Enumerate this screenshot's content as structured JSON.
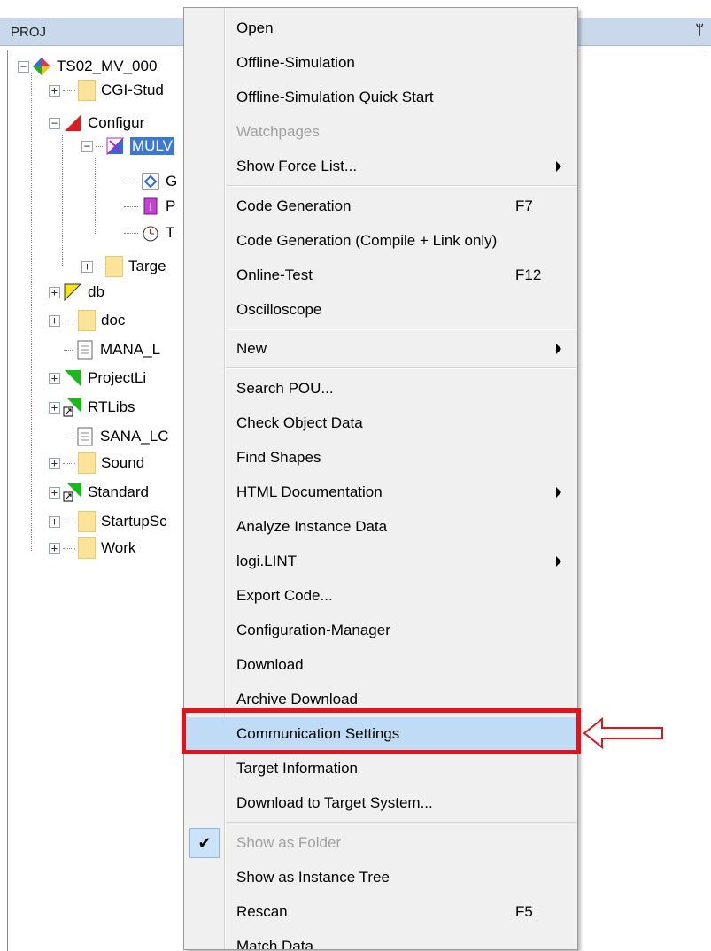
{
  "panel": {
    "title": "PROJ",
    "pin_icon": "pin-icon"
  },
  "tree": [
    {
      "label": "TS02_MV_000",
      "icon": "project-diamond-icon",
      "expander": "⊟"
    },
    {
      "label": "CGI-Stud",
      "icon": "folder-icon",
      "expander": "+"
    },
    {
      "label": "Configur",
      "icon": "configuration-triangle-icon",
      "expander": "−"
    },
    {
      "label": "MULV",
      "icon": "resource-icon",
      "expander": "−",
      "selected": true
    },
    {
      "label": "G",
      "icon": "global-variables-icon"
    },
    {
      "label": "P",
      "icon": "program-icon"
    },
    {
      "label": "T",
      "icon": "task-timer-icon"
    },
    {
      "label": "Targe",
      "icon": "folder-icon",
      "expander": "+"
    },
    {
      "label": "db",
      "icon": "db-triangle-icon",
      "expander": "+"
    },
    {
      "label": "doc",
      "icon": "folder-icon",
      "expander": "+"
    },
    {
      "label": "MANA_L",
      "icon": "file-icon"
    },
    {
      "label": "ProjectLi",
      "icon": "library-triangle-icon",
      "expander": "+"
    },
    {
      "label": "RTLibs",
      "icon": "linked-library-icon",
      "expander": "+"
    },
    {
      "label": "SANA_LC",
      "icon": "file-icon"
    },
    {
      "label": "Sound",
      "icon": "folder-icon",
      "expander": "+"
    },
    {
      "label": "Standard",
      "icon": "linked-library-icon",
      "expander": "+"
    },
    {
      "label": "StartupSc",
      "icon": "folder-icon",
      "expander": "+"
    },
    {
      "label": "Work",
      "icon": "folder-icon",
      "expander": "+"
    }
  ],
  "menu": {
    "items": [
      {
        "label": "Open"
      },
      {
        "label": "Offline-Simulation"
      },
      {
        "label": "Offline-Simulation Quick Start"
      },
      {
        "label": "Watchpages",
        "disabled": true
      },
      {
        "label": "Show Force List...",
        "submenu": true
      },
      {
        "label": "Code Generation",
        "shortcut": "F7"
      },
      {
        "label": "Code Generation (Compile + Link only)"
      },
      {
        "label": "Online-Test",
        "shortcut": "F12"
      },
      {
        "label": "Oscilloscope"
      },
      {
        "label": "New",
        "submenu": true
      },
      {
        "label": "Search POU..."
      },
      {
        "label": "Check Object Data"
      },
      {
        "label": "Find Shapes"
      },
      {
        "label": "HTML Documentation",
        "submenu": true
      },
      {
        "label": "Analyze Instance Data"
      },
      {
        "label": "logi.LINT",
        "submenu": true
      },
      {
        "label": "Export Code..."
      },
      {
        "label": "Configuration-Manager"
      },
      {
        "label": "Download"
      },
      {
        "label": "Archive Download"
      },
      {
        "label": "Communication Settings",
        "highlighted": true
      },
      {
        "label": "Target Information"
      },
      {
        "label": "Download to Target System..."
      },
      {
        "label": "Show as Folder",
        "disabled": true,
        "checked": true
      },
      {
        "label": "Show as Instance Tree"
      },
      {
        "label": "Rescan",
        "shortcut": "F5"
      },
      {
        "label": "Match Data"
      }
    ],
    "check_glyph": "✔"
  },
  "annotation": {
    "highlight_color": "#e2141b",
    "arrow": "left-arrow-outline"
  },
  "colors": {
    "panel_header": "#c9d8ea",
    "menu_background": "#f0f0f0",
    "menu_highlight": "#bfdbf6",
    "tree_selection": "#3a77d6"
  }
}
